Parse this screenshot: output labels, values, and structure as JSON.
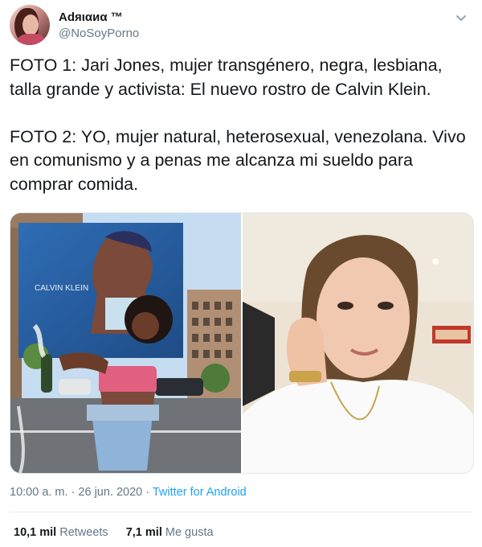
{
  "author": {
    "name": "Adяιαиα ™",
    "handle": "@NoSoyPorno"
  },
  "tweet": {
    "text": "FOTO 1: Jari Jones, mujer transgénero, negra, lesbiana, talla grande y activista: El nuevo rostro de Calvin Klein.\n\nFOTO 2: YO, mujer natural, heterosexual, venezolana. Vivo en comunismo y a penas me alcanza mi sueldo para comprar comida.",
    "timestamp": "10:00 a. m. · 26 jun. 2020",
    "separator": " · ",
    "source": "Twitter for Android"
  },
  "media": {
    "photo1_billboard_text": "CALVIN KLEIN"
  },
  "stats": {
    "retweets_count": "10,1 mil",
    "retweets_label": "Retweets",
    "likes_count": "7,1 mil",
    "likes_label": "Me gusta"
  },
  "icons": {
    "more": "chevron-down-icon"
  },
  "colors": {
    "link": "#1da1f2",
    "secondary_text": "#657786",
    "primary_text": "#14171a"
  }
}
